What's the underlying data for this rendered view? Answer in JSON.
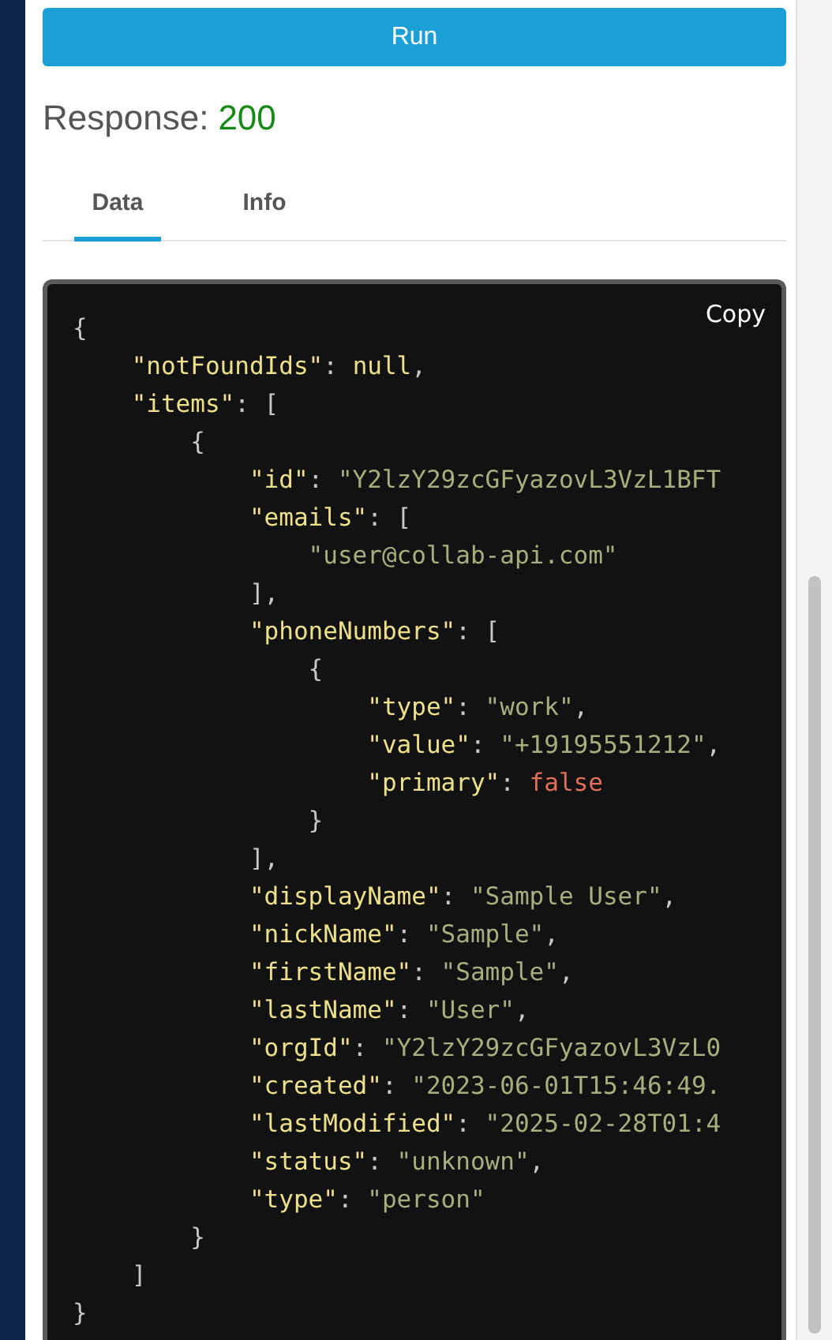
{
  "run_button": {
    "label": "Run"
  },
  "response": {
    "label": "Response:",
    "status": "200"
  },
  "tabs": [
    {
      "label": "Data",
      "selected": true
    },
    {
      "label": "Info",
      "selected": false
    }
  ],
  "code_block": {
    "copy_label": "Copy",
    "lines": [
      {
        "tokens": [
          {
            "kind": "punct",
            "text": "{"
          }
        ],
        "children": [
          {
            "tokens": [
              {
                "kind": "key",
                "text": "\"notFoundIds\""
              },
              {
                "kind": "punct",
                "text": ": "
              },
              {
                "kind": "null",
                "text": "null"
              },
              {
                "kind": "punct",
                "text": ","
              }
            ]
          },
          {
            "tokens": [
              {
                "kind": "key",
                "text": "\"items\""
              },
              {
                "kind": "punct",
                "text": ": ["
              }
            ],
            "children": [
              {
                "tokens": [
                  {
                    "kind": "punct",
                    "text": "{"
                  }
                ],
                "children": [
                  {
                    "tokens": [
                      {
                        "kind": "key",
                        "text": "\"id\""
                      },
                      {
                        "kind": "punct",
                        "text": ": "
                      },
                      {
                        "kind": "string",
                        "text": "\"Y2lzY29zcGFyazovL3VzL1BFT"
                      }
                    ]
                  },
                  {
                    "tokens": [
                      {
                        "kind": "key",
                        "text": "\"emails\""
                      },
                      {
                        "kind": "punct",
                        "text": ": ["
                      }
                    ],
                    "children": [
                      {
                        "tokens": [
                          {
                            "kind": "string",
                            "text": "\"user@collab-api.com\""
                          }
                        ]
                      }
                    ]
                  },
                  {
                    "tokens": [
                      {
                        "kind": "punct",
                        "text": "],"
                      }
                    ]
                  },
                  {
                    "tokens": [
                      {
                        "kind": "key",
                        "text": "\"phoneNumbers\""
                      },
                      {
                        "kind": "punct",
                        "text": ": ["
                      }
                    ],
                    "children": [
                      {
                        "tokens": [
                          {
                            "kind": "punct",
                            "text": "{"
                          }
                        ],
                        "children": [
                          {
                            "tokens": [
                              {
                                "kind": "key",
                                "text": "\"type\""
                              },
                              {
                                "kind": "punct",
                                "text": ": "
                              },
                              {
                                "kind": "string",
                                "text": "\"work\""
                              },
                              {
                                "kind": "punct",
                                "text": ","
                              }
                            ]
                          },
                          {
                            "tokens": [
                              {
                                "kind": "key",
                                "text": "\"value\""
                              },
                              {
                                "kind": "punct",
                                "text": ": "
                              },
                              {
                                "kind": "string",
                                "text": "\"+19195551212\""
                              },
                              {
                                "kind": "punct",
                                "text": ","
                              }
                            ]
                          },
                          {
                            "tokens": [
                              {
                                "kind": "key",
                                "text": "\"primary\""
                              },
                              {
                                "kind": "punct",
                                "text": ": "
                              },
                              {
                                "kind": "bool",
                                "text": "false"
                              }
                            ]
                          }
                        ]
                      },
                      {
                        "tokens": [
                          {
                            "kind": "punct",
                            "text": "}"
                          }
                        ]
                      }
                    ]
                  },
                  {
                    "tokens": [
                      {
                        "kind": "punct",
                        "text": "],"
                      }
                    ]
                  },
                  {
                    "tokens": [
                      {
                        "kind": "key",
                        "text": "\"displayName\""
                      },
                      {
                        "kind": "punct",
                        "text": ": "
                      },
                      {
                        "kind": "string",
                        "text": "\"Sample User\""
                      },
                      {
                        "kind": "punct",
                        "text": ","
                      }
                    ]
                  },
                  {
                    "tokens": [
                      {
                        "kind": "key",
                        "text": "\"nickName\""
                      },
                      {
                        "kind": "punct",
                        "text": ": "
                      },
                      {
                        "kind": "string",
                        "text": "\"Sample\""
                      },
                      {
                        "kind": "punct",
                        "text": ","
                      }
                    ]
                  },
                  {
                    "tokens": [
                      {
                        "kind": "key",
                        "text": "\"firstName\""
                      },
                      {
                        "kind": "punct",
                        "text": ": "
                      },
                      {
                        "kind": "string",
                        "text": "\"Sample\""
                      },
                      {
                        "kind": "punct",
                        "text": ","
                      }
                    ]
                  },
                  {
                    "tokens": [
                      {
                        "kind": "key",
                        "text": "\"lastName\""
                      },
                      {
                        "kind": "punct",
                        "text": ": "
                      },
                      {
                        "kind": "string",
                        "text": "\"User\""
                      },
                      {
                        "kind": "punct",
                        "text": ","
                      }
                    ]
                  },
                  {
                    "tokens": [
                      {
                        "kind": "key",
                        "text": "\"orgId\""
                      },
                      {
                        "kind": "punct",
                        "text": ": "
                      },
                      {
                        "kind": "string",
                        "text": "\"Y2lzY29zcGFyazovL3VzL0"
                      }
                    ]
                  },
                  {
                    "tokens": [
                      {
                        "kind": "key",
                        "text": "\"created\""
                      },
                      {
                        "kind": "punct",
                        "text": ": "
                      },
                      {
                        "kind": "string",
                        "text": "\"2023-06-01T15:46:49."
                      }
                    ]
                  },
                  {
                    "tokens": [
                      {
                        "kind": "key",
                        "text": "\"lastModified\""
                      },
                      {
                        "kind": "punct",
                        "text": ": "
                      },
                      {
                        "kind": "string",
                        "text": "\"2025-02-28T01:4"
                      }
                    ]
                  },
                  {
                    "tokens": [
                      {
                        "kind": "key",
                        "text": "\"status\""
                      },
                      {
                        "kind": "punct",
                        "text": ": "
                      },
                      {
                        "kind": "string",
                        "text": "\"unknown\""
                      },
                      {
                        "kind": "punct",
                        "text": ","
                      }
                    ]
                  },
                  {
                    "tokens": [
                      {
                        "kind": "key",
                        "text": "\"type\""
                      },
                      {
                        "kind": "punct",
                        "text": ": "
                      },
                      {
                        "kind": "string",
                        "text": "\"person\""
                      }
                    ]
                  }
                ]
              },
              {
                "tokens": [
                  {
                    "kind": "punct",
                    "text": "}"
                  }
                ]
              }
            ]
          },
          {
            "tokens": [
              {
                "kind": "punct",
                "text": "]"
              }
            ]
          }
        ]
      },
      {
        "tokens": [
          {
            "kind": "punct",
            "text": "}"
          }
        ]
      }
    ]
  }
}
